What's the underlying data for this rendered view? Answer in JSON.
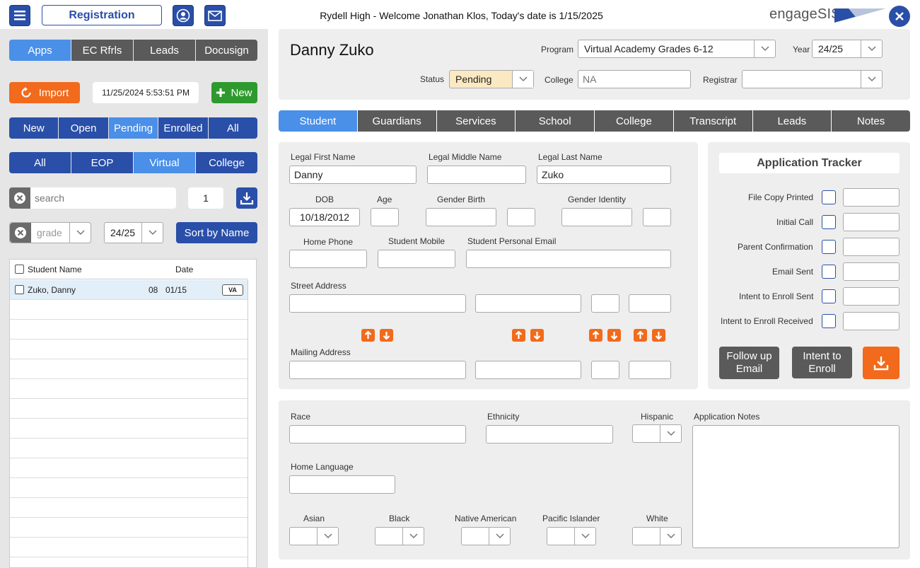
{
  "topbar": {
    "registration_label": "Registration",
    "welcome_text": "Rydell High - Welcome Jonathan Klos, Today's date is 1/15/2025",
    "logo_text": "engageSIS"
  },
  "left": {
    "top_tabs": [
      "Apps",
      "EC Rfrls",
      "Leads",
      "Docusign"
    ],
    "import_label": "Import",
    "timestamp": "11/25/2024 5:53:51 PM",
    "new_label": "New",
    "status_filters": [
      "New",
      "Open",
      "Pending",
      "Enrolled",
      "All"
    ],
    "program_filters": [
      "All",
      "EOP",
      "Virtual",
      "College"
    ],
    "search_placeholder": "search",
    "page_number": "1",
    "grade_placeholder": "grade",
    "year_value": "24/25",
    "sort_label": "Sort by Name",
    "list_headers": {
      "name": "Student Name",
      "date": "Date"
    },
    "students": [
      {
        "name": "Zuko, Danny",
        "grade": "08",
        "date": "01/15",
        "badge": "VA"
      }
    ]
  },
  "header": {
    "student_name": "Danny Zuko",
    "program_label": "Program",
    "program_value": "Virtual Academy Grades 6-12",
    "year_label": "Year",
    "year_value": "24/25",
    "status_label": "Status",
    "status_value": "Pending",
    "college_label": "College",
    "college_placeholder": "NA",
    "registrar_label": "Registrar",
    "registrar_value": ""
  },
  "tabs": [
    "Student",
    "Guardians",
    "Services",
    "School",
    "College",
    "Transcript",
    "Leads",
    "Notes"
  ],
  "student_form": {
    "legal_first_name_label": "Legal First Name",
    "legal_first_name": "Danny",
    "legal_middle_name_label": "Legal Middle Name",
    "legal_middle_name": "",
    "legal_last_name_label": "Legal Last Name",
    "legal_last_name": "Zuko",
    "dob_label": "DOB",
    "dob": "10/18/2012",
    "age_label": "Age",
    "gender_birth_label": "Gender Birth",
    "gender_identity_label": "Gender Identity",
    "home_phone_label": "Home Phone",
    "student_mobile_label": "Student Mobile",
    "personal_email_label": "Student Personal Email",
    "street_address_label": "Street Address",
    "mailing_address_label": "Mailing Address"
  },
  "tracker": {
    "title": "Application Tracker",
    "items": [
      "File Copy Printed",
      "Initial Call",
      "Parent Confirmation",
      "Email Sent",
      "Intent to Enroll Sent",
      "Intent to Enroll Received"
    ],
    "follow_up_label": "Follow up Email",
    "intent_label": "Intent to Enroll"
  },
  "demographics": {
    "race_label": "Race",
    "ethnicity_label": "Ethnicity",
    "hispanic_label": "Hispanic",
    "app_notes_label": "Application Notes",
    "home_language_label": "Home Language",
    "asian_label": "Asian",
    "black_label": "Black",
    "native_american_label": "Native American",
    "pacific_islander_label": "Pacific Islander",
    "white_label": "White"
  },
  "colors": {
    "primary": "#2a4fa8",
    "accent": "#4a8fe8",
    "orange": "#f26a1b",
    "green": "#2e9a2e",
    "dark": "#5a5a5a"
  }
}
